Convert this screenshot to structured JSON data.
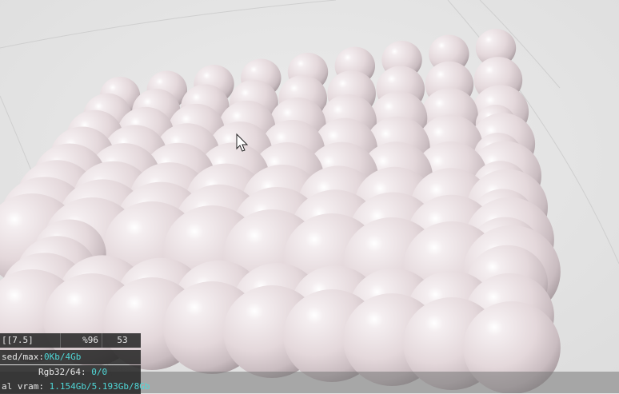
{
  "viewport": {
    "background": "#e6e6e6",
    "sphere_color": "#e9dfe1"
  },
  "hud": {
    "row1": {
      "c1": "[[7.5]",
      "c2": "%96",
      "c3": "53"
    },
    "row2": {
      "label": "sed/max:",
      "value": "0Kb/4Gb"
    },
    "row3": {
      "label": "Rgb32/64:",
      "value": "0/0"
    },
    "row4": {
      "label": "al vram:",
      "value": "1.154Gb/5.193Gb/8Gb"
    }
  },
  "cursor": "arrow-cursor-icon"
}
